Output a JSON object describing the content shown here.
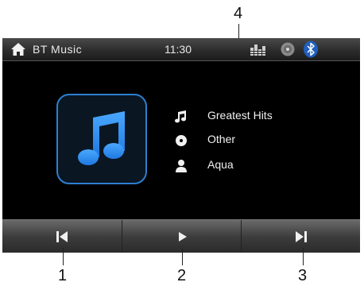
{
  "callouts": {
    "top": "4",
    "bottom": [
      "1",
      "2",
      "3"
    ]
  },
  "statusbar": {
    "title": "BT Music",
    "time": "11:30",
    "icons": [
      "home-icon",
      "equalizer-icon",
      "disc-icon",
      "bluetooth-icon"
    ]
  },
  "track": {
    "album": "Greatest Hits",
    "genre": "Other",
    "artist": "Aqua",
    "album_art_icon": "music-note-icon"
  },
  "controls": {
    "buttons": [
      "previous-track",
      "play",
      "next-track"
    ]
  },
  "colors": {
    "accent": "#2d8ae6",
    "screen_bg": "#000000",
    "text": "#f0f0f0"
  }
}
